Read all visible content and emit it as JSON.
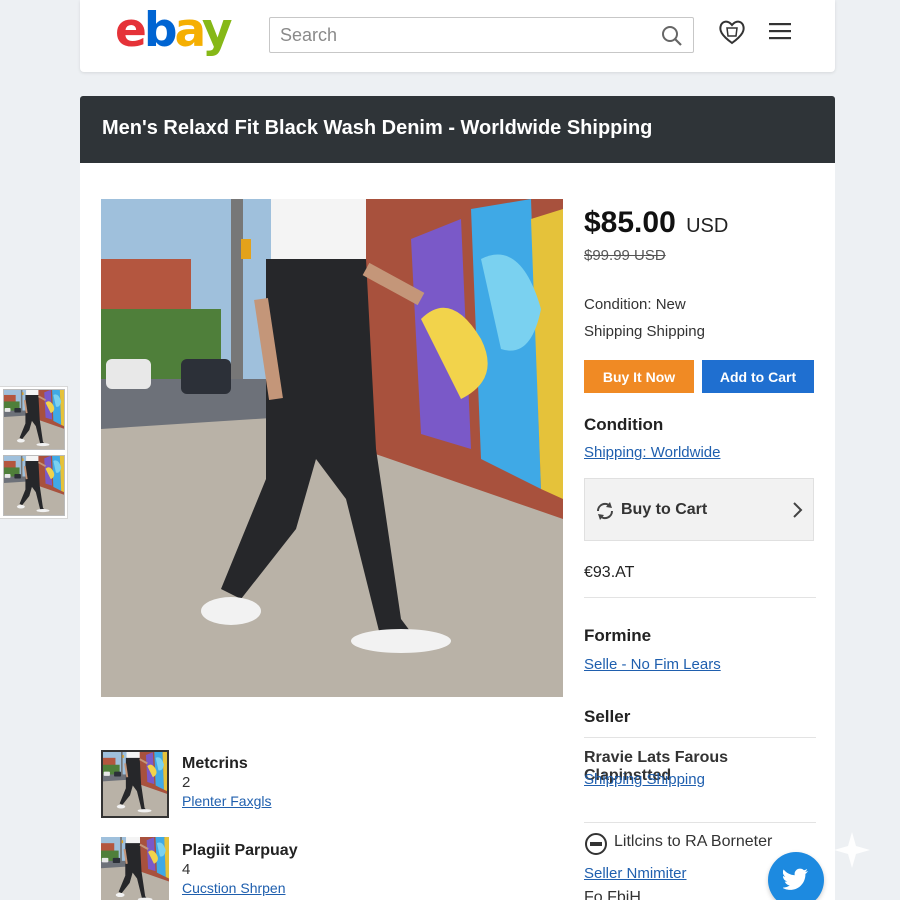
{
  "header": {
    "logo": {
      "e": "e",
      "b": "b",
      "a": "a",
      "y": "y"
    },
    "search_placeholder": "Search",
    "icons": [
      "search-icon",
      "heart-icon",
      "menu-icon"
    ]
  },
  "title": "Men's Relaxd Fit Black Wash Denim - Worldwide Shipping",
  "product": {
    "price": "$85.00",
    "price_currency": "USD",
    "old_price": "$99.99 USD",
    "condition_label": "Condition:",
    "condition_value": "New",
    "shipping_line": "Shipping Shipping",
    "buy_now_label": "Buy It Now",
    "add_to_cart_label": "Add to Cart",
    "condition_heading": "Condition",
    "shipping_link": "Shipping: Worldwide",
    "buy_to_cart_label": "Buy to Cart",
    "currency_text": "€93.AT"
  },
  "sections": {
    "formine_heading": "Formine",
    "formine_link": "Selle - No Fim Lears",
    "seller_heading": "Seller",
    "seller_name": "Rravie Lats Farous Clapinstted",
    "seller_link": "Shipping Shipping",
    "note_text": "Litlcins to RA Borneter",
    "note_link": "Seller Nmimiter",
    "cut_text": "Fo.FbiH"
  },
  "related": [
    {
      "title": "Metcrins",
      "qty": "2",
      "link": "Plenter Faxgls"
    },
    {
      "title": "Plagiit Parpuay",
      "qty": "4",
      "link": "Cucstion Shrpen"
    }
  ],
  "colors": {
    "brand_red": "#e53238",
    "brand_blue": "#0064d2",
    "brand_yellow": "#f5af02",
    "brand_green": "#86b817",
    "buy_now": "#f08a24",
    "add_to_cart": "#1f6fd0",
    "title_bar": "#2f3438",
    "link": "#1f5fae"
  }
}
